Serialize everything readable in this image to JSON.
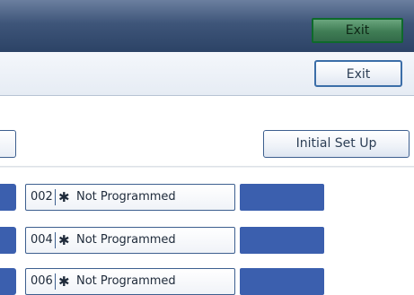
{
  "header": {
    "exit_label": "Exit"
  },
  "toolbar": {
    "exit_label": "Exit"
  },
  "setup": {
    "initial_setup_label": "Initial Set Up"
  },
  "entries": [
    {
      "number": "002",
      "star": "✱",
      "label": "Not Programmed"
    },
    {
      "number": "004",
      "star": "✱",
      "label": "Not Programmed"
    },
    {
      "number": "006",
      "star": "✱",
      "label": "Not Programmed"
    }
  ],
  "colors": {
    "header_bg": "#2c4366",
    "exit_green": "#3f7d55",
    "accent_blue": "#3b5fae",
    "button_border": "#3d5f8f"
  }
}
